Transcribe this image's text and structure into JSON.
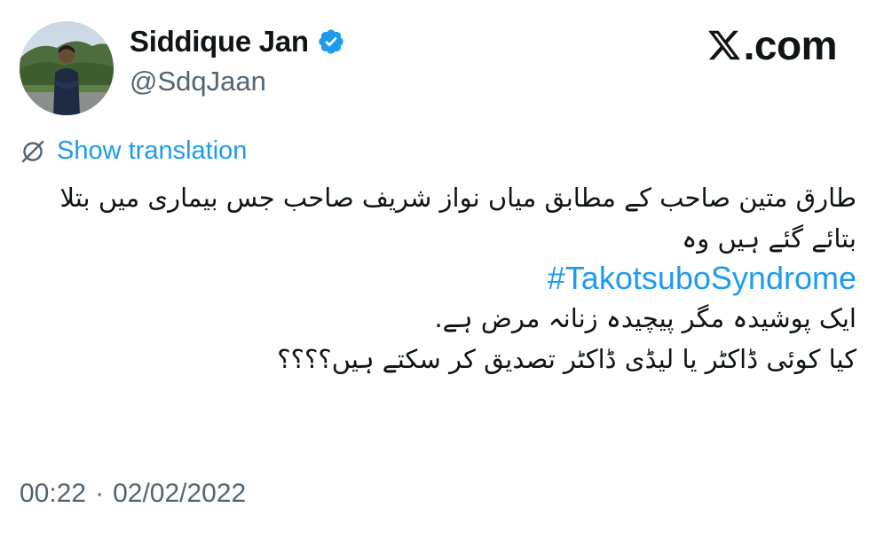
{
  "author": {
    "display_name": "Siddique Jan",
    "handle": "@SdqJaan",
    "verified": true
  },
  "brand": {
    "logo_icon": "x-logo-icon",
    "site_suffix": ".com"
  },
  "translate": {
    "label": "Show translation",
    "icon": "globe-slash-icon"
  },
  "tweet": {
    "line1": "طارق متین صاحب کے مطابق میاں نواز شریف صاحب جس بیماری میں بتلا",
    "line2": "بتائے گئے ہیں وہ",
    "hashtag": "#TakotsuboSyndrome",
    "line3": "ایک پوشیدہ مگر پیچیدہ زنانہ مرض ہے.",
    "line4": "کیا کوئی ڈاکٹر یا لیڈی ڈاکٹر تصدیق کر سکتے ہیں؟؟؟؟"
  },
  "meta": {
    "time": "00:22",
    "separator": "·",
    "date": "02/02/2022"
  },
  "colors": {
    "link": "#1d9bf0",
    "secondary_text": "#536471",
    "verified_badge": "#1d9bf0"
  }
}
